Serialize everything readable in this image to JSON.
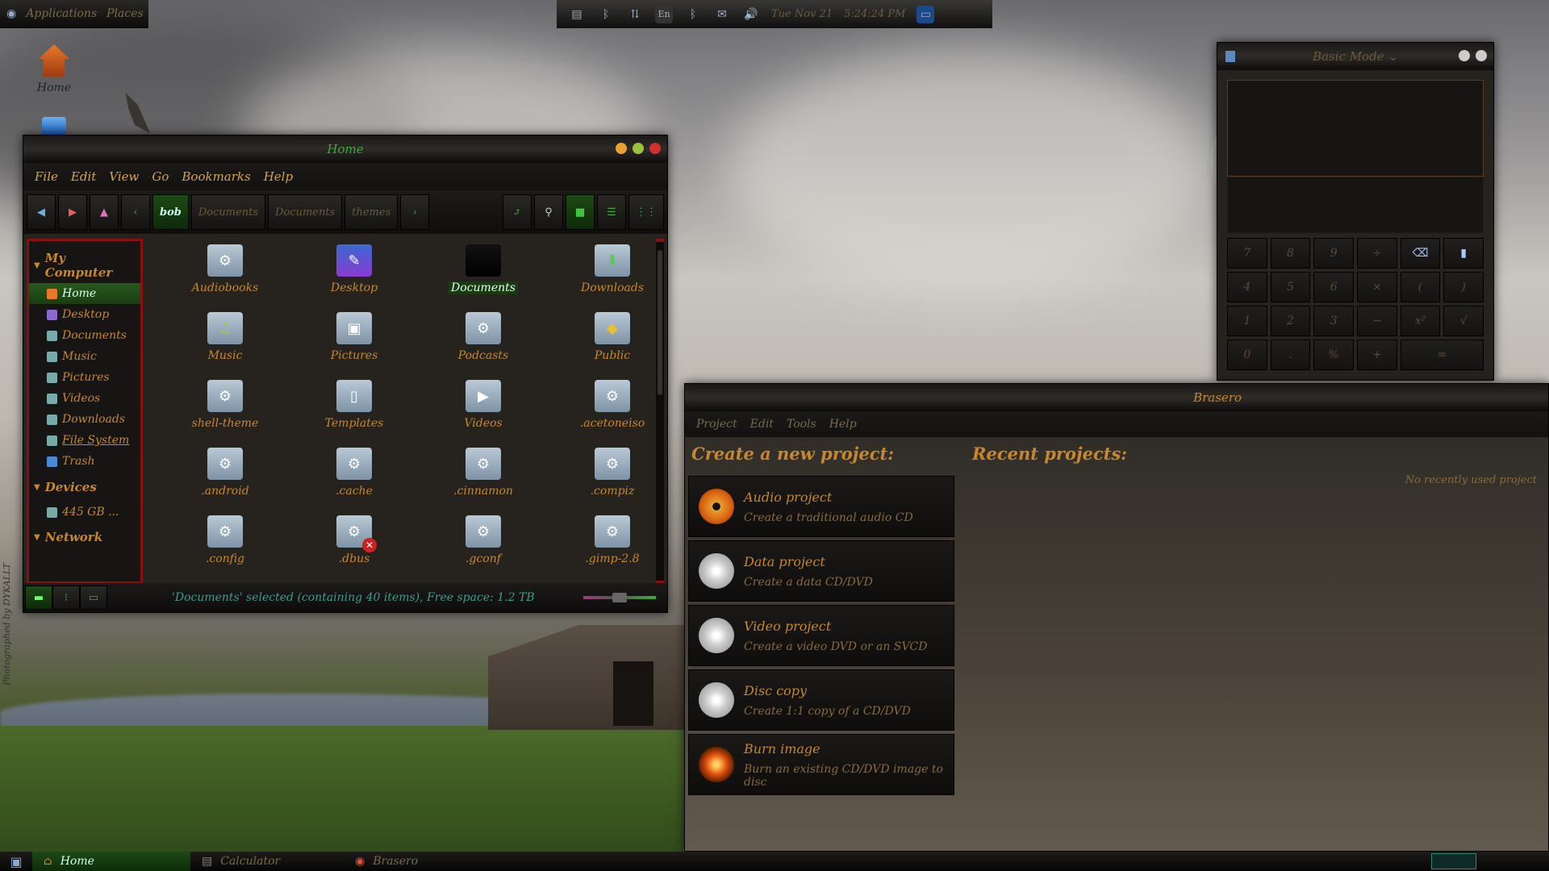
{
  "top_panel": {
    "apps": "Applications",
    "places": "Places"
  },
  "tray": {
    "lang": "En",
    "date": "Tue Nov 21",
    "time": "5:24:24 PM"
  },
  "desktop": {
    "home": "Home"
  },
  "watermark": "Photographed by DYKALLT",
  "file_manager": {
    "title": "Home",
    "menu": [
      "File",
      "Edit",
      "View",
      "Go",
      "Bookmarks",
      "Help"
    ],
    "path": [
      "bob",
      "Documents",
      "Documents",
      "themes"
    ],
    "sidebar": {
      "my_computer": "My Computer",
      "items": [
        "Home",
        "Desktop",
        "Documents",
        "Music",
        "Pictures",
        "Videos",
        "Downloads",
        "File System",
        "Trash"
      ],
      "devices": "Devices",
      "device_item": "445 GB ...",
      "network": "Network"
    },
    "files": [
      "Audiobooks",
      "Desktop",
      "Documents",
      "Downloads",
      "Music",
      "Pictures",
      "Podcasts",
      "Public",
      "shell-theme",
      "Templates",
      "Videos",
      ".acetoneiso",
      ".android",
      ".cache",
      ".cinnamon",
      ".compiz",
      ".config",
      ".dbus",
      ".gconf",
      ".gimp-2.8"
    ],
    "selected": "Documents",
    "status": "'Documents' selected (containing 40 items), Free space: 1.2 TB"
  },
  "calculator": {
    "mode": "Basic Mode",
    "buttons": [
      "7",
      "8",
      "9",
      "÷",
      "",
      "",
      "4",
      "5",
      "6",
      "×",
      "(",
      ")",
      "1",
      "2",
      "3",
      "−",
      "x²",
      "√",
      "0",
      ".",
      "%",
      "+",
      "="
    ]
  },
  "brasero": {
    "title": "Brasero",
    "menu": [
      "Project",
      "Edit",
      "Tools",
      "Help"
    ],
    "create_heading": "Create a new project:",
    "recent_heading": "Recent projects:",
    "no_recent": "No recently used project",
    "projects": [
      {
        "title": "Audio project",
        "desc": "Create a traditional audio CD"
      },
      {
        "title": "Data project",
        "desc": "Create a data CD/DVD"
      },
      {
        "title": "Video project",
        "desc": "Create a video DVD or an SVCD"
      },
      {
        "title": "Disc copy",
        "desc": "Create 1:1 copy of a CD/DVD"
      },
      {
        "title": "Burn image",
        "desc": "Burn an existing CD/DVD image to disc"
      }
    ]
  },
  "taskbar": [
    "Home",
    "Calculator",
    "Brasero"
  ],
  "colors": {
    "accent": "#c8862e",
    "selection": "#183c10",
    "border": "#8a1010"
  }
}
